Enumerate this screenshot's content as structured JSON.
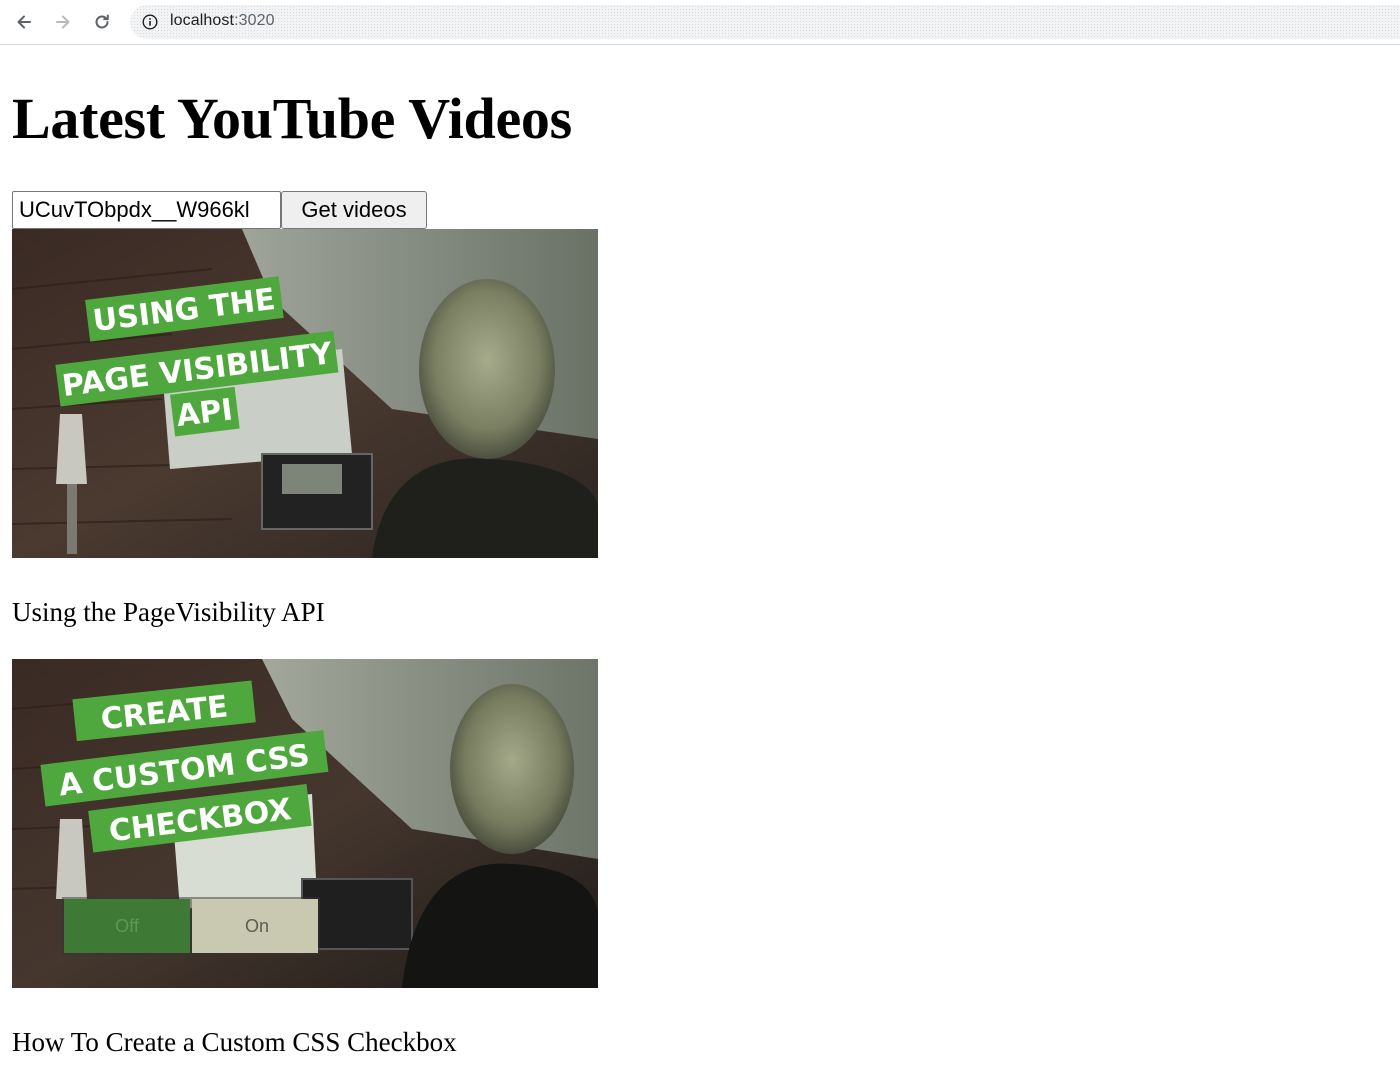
{
  "browser": {
    "url_host": "localhost",
    "url_port": ":3020"
  },
  "page": {
    "title": "Latest YouTube Videos",
    "channel_input_value": "UCuvTObpdx__W966kl",
    "button_label": "Get videos"
  },
  "videos": [
    {
      "title": "Using the PageVisibility API",
      "thumb_lines": [
        "USING THE",
        "PAGE VISIBILITY",
        "API"
      ]
    },
    {
      "title": "How To Create a Custom CSS Checkbox",
      "thumb_lines": [
        "CREATE",
        "A CUSTOM CSS",
        "CHECKBOX"
      ],
      "toggle_labels": [
        "Off",
        "On"
      ]
    }
  ],
  "colors": {
    "banner_green": "#4fa83d",
    "banner_text": "#ffffff"
  }
}
